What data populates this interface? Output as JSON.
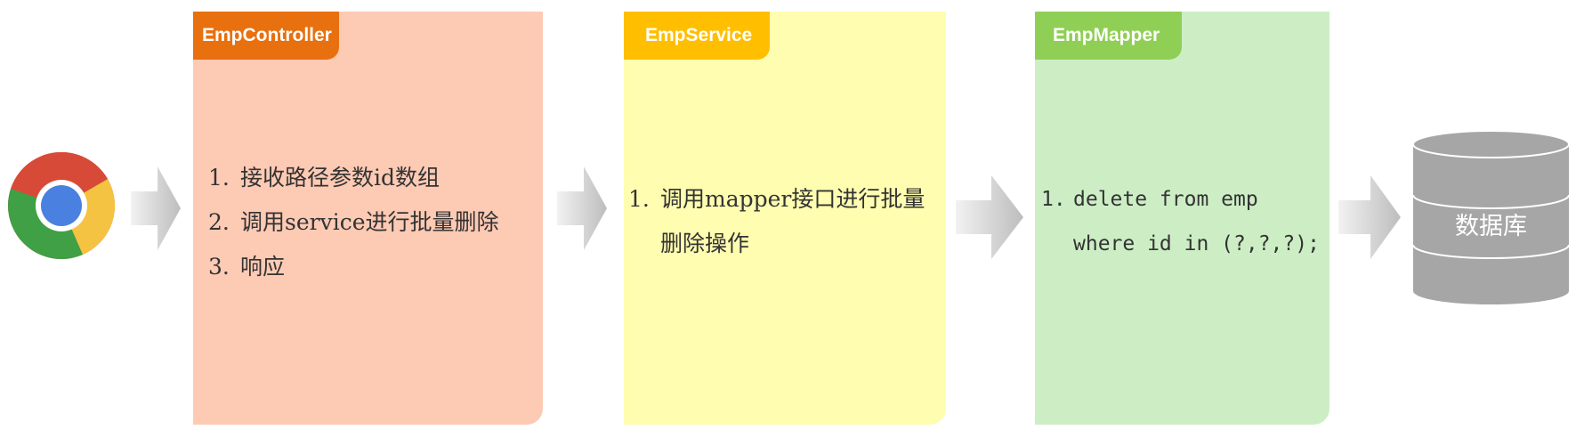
{
  "browser": {
    "icon": "chrome-browser-icon"
  },
  "arrow_color": "#c8c8c8",
  "panels": [
    {
      "title": "EmpController",
      "title_color": "#e8700f",
      "body_color": "#fdcab4",
      "steps": [
        {
          "num": "1.",
          "text": "接收路径参数id数组"
        },
        {
          "num": "2.",
          "text": "调用service进行批量删除"
        },
        {
          "num": "3.",
          "text": "响应"
        }
      ]
    },
    {
      "title": "EmpService",
      "title_color": "#ffbf00",
      "body_color": "#fffdb0",
      "steps": [
        {
          "num": "1.",
          "text": "调用mapper接口进行批量删除操作"
        }
      ]
    },
    {
      "title": "EmpMapper",
      "title_color": "#90cf55",
      "body_color": "#cdeec5",
      "steps": [
        {
          "num": "1.",
          "line1": "delete from emp",
          "line2": "where id in (?,?,?);"
        }
      ]
    }
  ],
  "database": {
    "label": "数据库",
    "color": "#a6a6a6"
  }
}
